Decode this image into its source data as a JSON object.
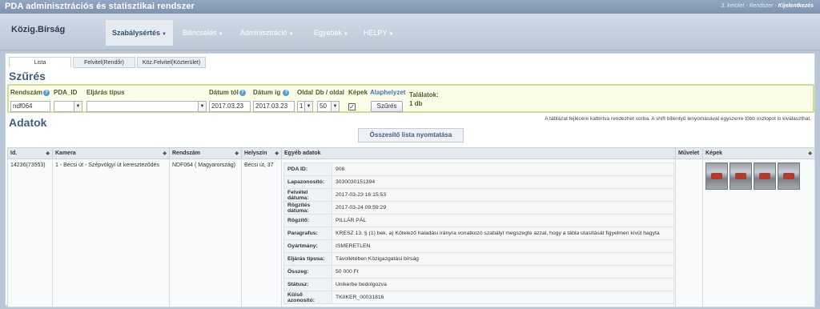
{
  "app": {
    "title": "PDA adminisztrációs és statisztikai rendszer",
    "district": "3. kerület",
    "system_label": "Rendszer",
    "logout": "Kijelentkezés"
  },
  "nav": {
    "brand": "Közig.Bírság",
    "items": [
      {
        "label": "Szabálysértés",
        "active": true
      },
      {
        "label": "Bilincselés",
        "active": false
      },
      {
        "label": "Adminisztráció",
        "active": false
      },
      {
        "label": "Egyebek",
        "active": false
      },
      {
        "label": "HELPY",
        "active": false
      }
    ]
  },
  "tabs": [
    {
      "label": "Lista",
      "active": true
    },
    {
      "label": "Felvitel(Rendőr)",
      "active": false
    },
    {
      "label": "Köz.Felvitel(Közterület)",
      "active": false
    }
  ],
  "filter": {
    "title": "Szűrés",
    "labels": {
      "rendszam": "Rendszám",
      "pda_id": "PDA_ID",
      "eljaras": "Eljárás típus",
      "datum_tol": "Dátum tól",
      "datum_ig": "Dátum ig",
      "oldal": "Oldal",
      "db_oldal": "Db / oldal",
      "kepek": "Képek",
      "alaphelyzet": "Alaphelyzet",
      "talalatok": "Találatok:"
    },
    "values": {
      "rendszam": "ndf064",
      "pda_id": "",
      "eljaras": "",
      "datum_tol": "2017.03.23",
      "datum_ig": "2017.03.23",
      "oldal": "1",
      "db_oldal": "50",
      "kepek_checked": "✓",
      "talalatok_count": "1 db"
    },
    "submit": "Szűrés"
  },
  "data_section": {
    "title": "Adatok",
    "hint": "A táblázat fejlécére kattintva rendezhet sorba. A shift billentyű lenyomásával egyszerre több oszlopot is kiválaszthat.",
    "print_button": "Összesítő lista nyomtatása",
    "columns": [
      "Id.",
      "Kamera",
      "Rendszám",
      "Helyszín",
      "Egyéb adatok",
      "Művelet",
      "Képek"
    ],
    "row": {
      "id": "14236(73553)",
      "kamera": "1 - Bécsi út - Szépvölgyi út kereszteződés",
      "rendszam": "NDF064 ( Magyarország)",
      "helyszin": "Bécsi út, 37",
      "details": [
        {
          "key": "PDA ID:",
          "value": "908"
        },
        {
          "key": "Lapazonosító:",
          "value": "3030030151394"
        },
        {
          "key": "Felvétel dátuma:",
          "value": "2017-03-23 16:15:53"
        },
        {
          "key": "Rögzítés dátuma:",
          "value": "2017-03-24 09:59:29"
        },
        {
          "key": "Rögzítő:",
          "value": "PILLÁR PÁL"
        },
        {
          "key": "Paragrafus:",
          "value": "KRESZ 13. § (1) bek. a) Kötelező haladási irányra vonatkozó szabályt megszegte azzal, hogy a tábla utasítását figyelmen kívül hagyta"
        },
        {
          "key": "Gyártmány:",
          "value": "ISMERETLEN"
        },
        {
          "key": "Eljárás típusa:",
          "value": "Távollétében Közigazgatási bírság"
        },
        {
          "key": "Összeg:",
          "value": "50 000 Ft"
        },
        {
          "key": "Státusz:",
          "value": "Unikerbe bedolgozva"
        },
        {
          "key": "Külső azonosító:",
          "value": "TKIIKER_00031816"
        }
      ],
      "image_count": 4
    }
  }
}
